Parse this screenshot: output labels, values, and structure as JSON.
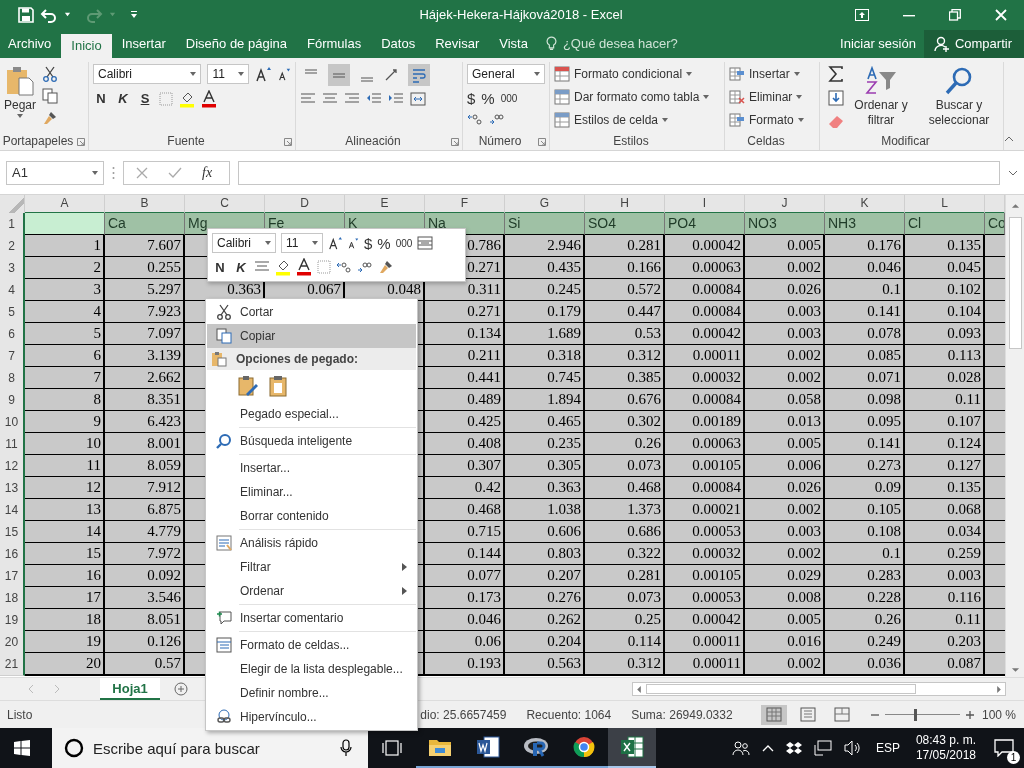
{
  "title_bar": {
    "title": "Hájek-Hekera-Hájková2018 - Excel"
  },
  "tabs": [
    {
      "label": "Archivo",
      "selected": false
    },
    {
      "label": "Inicio",
      "selected": true
    },
    {
      "label": "Insertar",
      "selected": false
    },
    {
      "label": "Diseño de página",
      "selected": false
    },
    {
      "label": "Fórmulas",
      "selected": false
    },
    {
      "label": "Datos",
      "selected": false
    },
    {
      "label": "Revisar",
      "selected": false
    },
    {
      "label": "Vista",
      "selected": false
    }
  ],
  "tell_me": {
    "placeholder": "¿Qué desea hacer?"
  },
  "account": {
    "sign_in": "Iniciar sesión",
    "share": "Compartir"
  },
  "ribbon": {
    "clipboard": {
      "paste": "Pegar",
      "group": "Portapapeles"
    },
    "font": {
      "name": "Calibri",
      "size": "11",
      "bold": "N",
      "italic": "K",
      "underline": "S",
      "group": "Fuente"
    },
    "alignment": {
      "top_buttons": [
        {
          "selected": false
        },
        {
          "selected": true
        },
        {
          "selected": false
        }
      ],
      "wrap_text": {
        "selected": true
      },
      "group": "Alineación"
    },
    "number": {
      "format": "General",
      "currency": "$",
      "percent": "%",
      "thousands": "000",
      "group": "Número"
    },
    "styles": {
      "items": [
        "Formato condicional",
        "Dar formato como tabla",
        "Estilos de celda"
      ],
      "group": "Estilos"
    },
    "cells": {
      "items": [
        "Insertar",
        "Eliminar",
        "Formato"
      ],
      "group": "Celdas"
    },
    "editing": {
      "sort": "Ordenar y filtrar",
      "find": "Buscar y seleccionar",
      "group": "Modificar"
    }
  },
  "formula_bar": {
    "name_box": "A1",
    "function": "fx"
  },
  "grid": {
    "columns": [
      "A",
      "B",
      "C",
      "D",
      "E",
      "F",
      "G",
      "H",
      "I",
      "J",
      "K",
      "L"
    ],
    "header_row": {
      "row": "1",
      "cells": {
        "B": "Ca",
        "C": "Mg",
        "D": "Fe",
        "E": "K",
        "F": "Na",
        "G": "Si",
        "H": "SO4",
        "I": "PO4",
        "J": "NO3",
        "K": "NH3",
        "L": "Cl",
        "M": "Co"
      }
    },
    "rows": [
      {
        "row": "2",
        "cells": {
          "A": "1",
          "B": "7.607",
          "F": "0.786",
          "G": "2.946",
          "H": "0.281",
          "I": "0.00042",
          "J": "0.005",
          "K": "0.176",
          "L": "0.135"
        }
      },
      {
        "row": "3",
        "cells": {
          "A": "2",
          "B": "0.255",
          "F": "0.271",
          "G": "0.435",
          "H": "0.166",
          "I": "0.00063",
          "J": "0.002",
          "K": "0.046",
          "L": "0.045"
        }
      },
      {
        "row": "4",
        "cells": {
          "A": "3",
          "B": "5.297",
          "C": "0.363",
          "D": "0.067",
          "E": "0.048",
          "F": "0.311",
          "G": "0.245",
          "H": "0.572",
          "I": "0.00084",
          "J": "0.026",
          "K": "0.1",
          "L": "0.102"
        }
      },
      {
        "row": "5",
        "cells": {
          "A": "4",
          "B": "7.923",
          "F": "0.271",
          "G": "0.179",
          "H": "0.447",
          "I": "0.00084",
          "J": "0.003",
          "K": "0.141",
          "L": "0.104"
        }
      },
      {
        "row": "6",
        "cells": {
          "A": "5",
          "B": "7.097",
          "F": "0.134",
          "G": "1.689",
          "H": "0.53",
          "I": "0.00042",
          "J": "0.003",
          "K": "0.078",
          "L": "0.093"
        }
      },
      {
        "row": "7",
        "cells": {
          "A": "6",
          "B": "3.139",
          "F": "0.211",
          "G": "0.318",
          "H": "0.312",
          "I": "0.00011",
          "J": "0.002",
          "K": "0.085",
          "L": "0.113"
        }
      },
      {
        "row": "8",
        "cells": {
          "A": "7",
          "B": "2.662",
          "F": "0.441",
          "G": "0.745",
          "H": "0.385",
          "I": "0.00032",
          "J": "0.002",
          "K": "0.071",
          "L": "0.028"
        }
      },
      {
        "row": "9",
        "cells": {
          "A": "8",
          "B": "8.351",
          "F": "0.489",
          "G": "1.894",
          "H": "0.676",
          "I": "0.00084",
          "J": "0.058",
          "K": "0.098",
          "L": "0.11"
        }
      },
      {
        "row": "10",
        "cells": {
          "A": "9",
          "B": "6.423",
          "F": "0.425",
          "G": "0.465",
          "H": "0.302",
          "I": "0.00189",
          "J": "0.013",
          "K": "0.095",
          "L": "0.107"
        }
      },
      {
        "row": "11",
        "cells": {
          "A": "10",
          "B": "8.001",
          "F": "0.408",
          "G": "0.235",
          "H": "0.26",
          "I": "0.00063",
          "J": "0.005",
          "K": "0.141",
          "L": "0.124"
        }
      },
      {
        "row": "12",
        "cells": {
          "A": "11",
          "B": "8.059",
          "F": "0.307",
          "G": "0.305",
          "H": "0.073",
          "I": "0.00105",
          "J": "0.006",
          "K": "0.273",
          "L": "0.127"
        }
      },
      {
        "row": "13",
        "cells": {
          "A": "12",
          "B": "7.912",
          "F": "0.42",
          "G": "0.363",
          "H": "0.468",
          "I": "0.00084",
          "J": "0.026",
          "K": "0.09",
          "L": "0.135"
        }
      },
      {
        "row": "14",
        "cells": {
          "A": "13",
          "B": "6.875",
          "F": "0.468",
          "G": "1.038",
          "H": "1.373",
          "I": "0.00021",
          "J": "0.002",
          "K": "0.105",
          "L": "0.068"
        }
      },
      {
        "row": "15",
        "cells": {
          "A": "14",
          "B": "4.779",
          "F": "0.715",
          "G": "0.606",
          "H": "0.686",
          "I": "0.00053",
          "J": "0.003",
          "K": "0.108",
          "L": "0.034"
        }
      },
      {
        "row": "16",
        "cells": {
          "A": "15",
          "B": "7.972",
          "F": "0.144",
          "G": "0.803",
          "H": "0.322",
          "I": "0.00032",
          "J": "0.002",
          "K": "0.1",
          "L": "0.259"
        }
      },
      {
        "row": "17",
        "cells": {
          "A": "16",
          "B": "0.092",
          "F": "0.077",
          "G": "0.207",
          "H": "0.281",
          "I": "0.00105",
          "J": "0.029",
          "K": "0.283",
          "L": "0.003"
        }
      },
      {
        "row": "18",
        "cells": {
          "A": "17",
          "B": "3.546",
          "F": "0.173",
          "G": "0.276",
          "H": "0.073",
          "I": "0.00053",
          "J": "0.008",
          "K": "0.228",
          "L": "0.116"
        }
      },
      {
        "row": "19",
        "cells": {
          "A": "18",
          "B": "8.051",
          "F": "0.046",
          "G": "0.262",
          "H": "0.25",
          "I": "0.00042",
          "J": "0.005",
          "K": "0.26",
          "L": "0.11"
        }
      },
      {
        "row": "20",
        "cells": {
          "A": "19",
          "B": "0.126",
          "F": "0.06",
          "G": "0.204",
          "H": "0.114",
          "I": "0.00011",
          "J": "0.016",
          "K": "0.249",
          "L": "0.203"
        }
      },
      {
        "row": "21",
        "cells": {
          "A": "20",
          "B": "0.57",
          "F": "0.193",
          "G": "0.563",
          "H": "0.312",
          "I": "0.00011",
          "J": "0.002",
          "K": "0.036",
          "L": "0.087"
        }
      }
    ]
  },
  "mini_toolbar": {
    "font": "Calibri",
    "size": "11",
    "currency": "$",
    "percent": "%",
    "thousands": "000",
    "bold": "N",
    "italic": "K"
  },
  "context_menu": {
    "items": [
      {
        "kind": "item",
        "label": "Cortar",
        "selected": false
      },
      {
        "kind": "item",
        "label": "Copiar",
        "selected": true
      },
      {
        "kind": "heading",
        "label": "Opciones de pegado:"
      },
      {
        "kind": "paste_icons"
      },
      {
        "kind": "item",
        "label": "Pegado especial...",
        "selected": false
      },
      {
        "kind": "separator"
      },
      {
        "kind": "item",
        "label": "Búsqueda inteligente",
        "selected": false
      },
      {
        "kind": "separator"
      },
      {
        "kind": "item",
        "label": "Insertar...",
        "selected": false
      },
      {
        "kind": "item",
        "label": "Eliminar...",
        "selected": false
      },
      {
        "kind": "item",
        "label": "Borrar contenido",
        "selected": false
      },
      {
        "kind": "separator"
      },
      {
        "kind": "item",
        "label": "Análisis rápido",
        "selected": false
      },
      {
        "kind": "submenu",
        "label": "Filtrar",
        "selected": false
      },
      {
        "kind": "submenu",
        "label": "Ordenar",
        "selected": false
      },
      {
        "kind": "separator"
      },
      {
        "kind": "item",
        "label": "Insertar comentario",
        "selected": false
      },
      {
        "kind": "separator"
      },
      {
        "kind": "item",
        "label": "Formato de celdas...",
        "selected": false
      },
      {
        "kind": "item",
        "label": "Elegir de la lista desplegable...",
        "selected": false
      },
      {
        "kind": "item",
        "label": "Definir nombre...",
        "selected": false
      },
      {
        "kind": "item",
        "label": "Hipervínculo...",
        "selected": false
      }
    ]
  },
  "sheet_tabs": [
    {
      "label": "Hoja1",
      "selected": true
    }
  ],
  "status_bar": {
    "mode": "Listo",
    "average": "dio: 25.6657459",
    "count": "Recuento: 1064",
    "sum": "Suma: 26949.0332",
    "views": [
      {
        "selected": true
      },
      {
        "selected": false
      },
      {
        "selected": false
      }
    ],
    "zoom": {
      "level": 0.4,
      "reading": "100 %"
    }
  },
  "taskbar": {
    "search": {
      "placeholder": "Escribe aquí para buscar"
    },
    "apps": [
      {
        "selected": false
      },
      {
        "selected": false
      },
      {
        "selected": false
      },
      {
        "selected": false
      },
      {
        "selected": true
      }
    ],
    "language": "ESP",
    "time": "08:43 p. m.",
    "date": "17/05/2018",
    "notifications": "1"
  }
}
